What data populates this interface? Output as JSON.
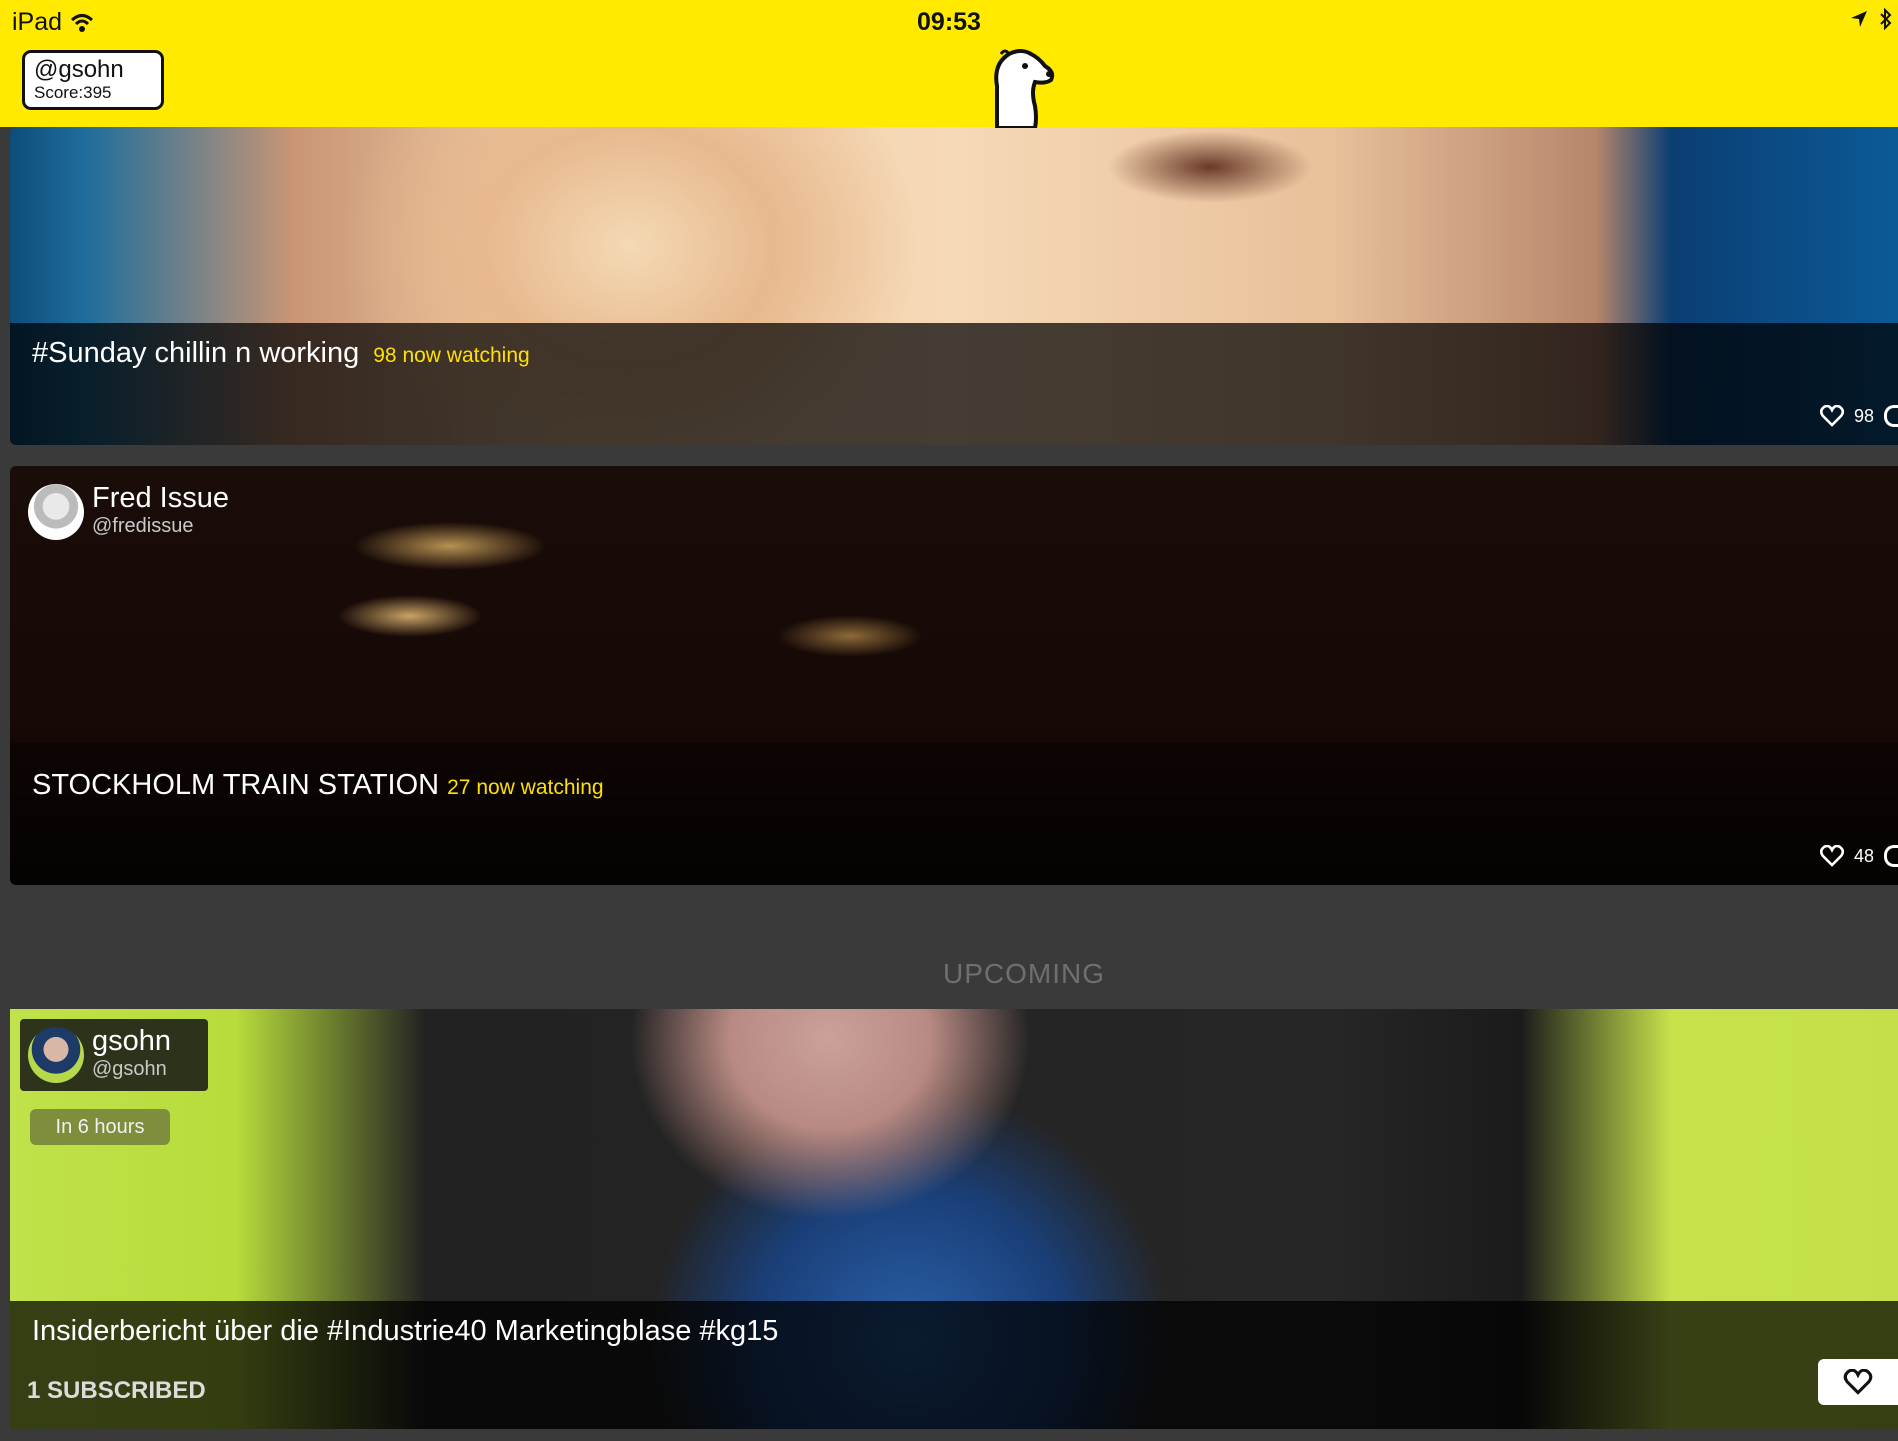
{
  "status_bar": {
    "device": "iPad",
    "time": "09:53"
  },
  "header": {
    "handle": "@gsohn",
    "score": "Score:395"
  },
  "streams": [
    {
      "title": "#Sunday chillin n working",
      "watching": "98 now watching",
      "likes": "98"
    },
    {
      "author_name": "Fred Issue",
      "author_handle": "@fredissue",
      "title": "STOCKHOLM TRAIN STATION",
      "watching": "27 now watching",
      "likes": "48"
    }
  ],
  "upcoming_label": "UPCOMING",
  "upcoming": {
    "author_name": "gsohn",
    "author_handle": "@gsohn",
    "time": "In 6 hours",
    "title": "Insiderbericht über die #Industrie40 Marketingblase #kg15",
    "subscribed": "1 SUBSCRIBED"
  },
  "colors": {
    "brand_yellow": "#ffea00",
    "watching_yellow": "#ffe000"
  },
  "icons": [
    "wifi-icon",
    "location-arrow-icon",
    "bluetooth-icon",
    "meerkat-logo",
    "heart-icon",
    "comment-icon"
  ]
}
